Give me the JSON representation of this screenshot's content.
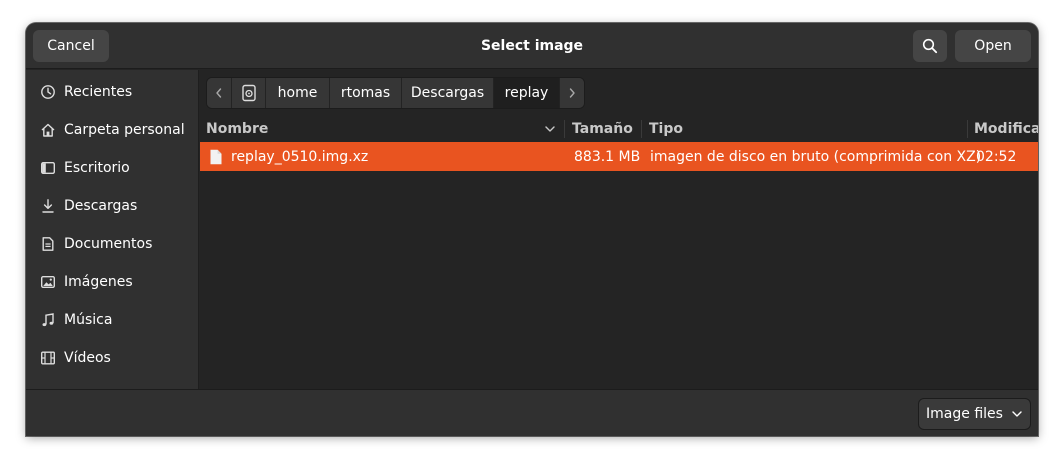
{
  "header": {
    "title": "Select image",
    "cancel_label": "Cancel",
    "open_label": "Open",
    "search_icon": "search-icon"
  },
  "sidebar": {
    "items": [
      {
        "label": "Recientes",
        "icon": "clock-icon"
      },
      {
        "label": "Carpeta personal",
        "icon": "home-icon"
      },
      {
        "label": "Escritorio",
        "icon": "desktop-icon"
      },
      {
        "label": "Descargas",
        "icon": "download-icon"
      },
      {
        "label": "Documentos",
        "icon": "document-icon"
      },
      {
        "label": "Imágenes",
        "icon": "image-icon"
      },
      {
        "label": "Música",
        "icon": "music-icon"
      },
      {
        "label": "Vídeos",
        "icon": "video-icon"
      }
    ]
  },
  "pathbar": {
    "crumbs": [
      "home",
      "rtomas",
      "Descargas",
      "replay"
    ],
    "active_crumb": "replay",
    "root_icon": "drive-icon"
  },
  "file_list": {
    "columns": [
      "Nombre",
      "Tamaño",
      "Tipo",
      "Modificado"
    ],
    "sort_column": "Nombre",
    "rows": [
      {
        "name": "replay_0510.img.xz",
        "size": "883.1 MB",
        "type": "imagen de disco en bruto (comprimida con XZ)",
        "modified": "02:52",
        "selected": true,
        "icon": "file-icon"
      }
    ]
  },
  "footer": {
    "filter_label": "Image files"
  },
  "colors": {
    "accent": "#e95420",
    "window_bg": "#242424",
    "sidebar_bg": "#303030",
    "button_bg": "#454545"
  }
}
